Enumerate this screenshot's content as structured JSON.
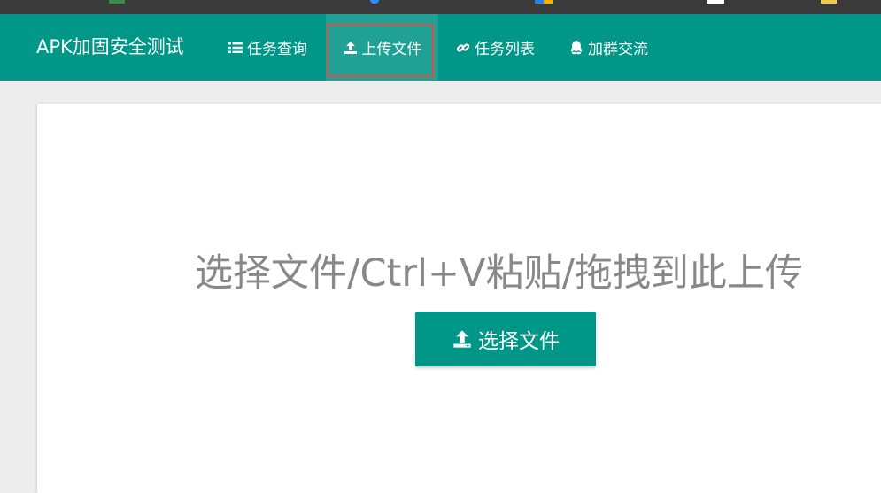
{
  "colors": {
    "primary": "#009688",
    "active_tab": "#1fa196",
    "highlight_border": "#e04b45",
    "page_bg": "#ededed",
    "drop_text": "#888888"
  },
  "header": {
    "brand": "APK加固安全测试",
    "nav": [
      {
        "label": "任务查询",
        "icon": "list-icon"
      },
      {
        "label": "上传文件",
        "icon": "upload-icon",
        "active": true
      },
      {
        "label": "任务列表",
        "icon": "link-icon"
      },
      {
        "label": "加群交流",
        "icon": "qq-icon"
      }
    ]
  },
  "main": {
    "drop_hint": "选择文件/Ctrl+V粘贴/拖拽到此上传",
    "upload_button": {
      "label": "选择文件",
      "icon": "upload-icon"
    }
  }
}
